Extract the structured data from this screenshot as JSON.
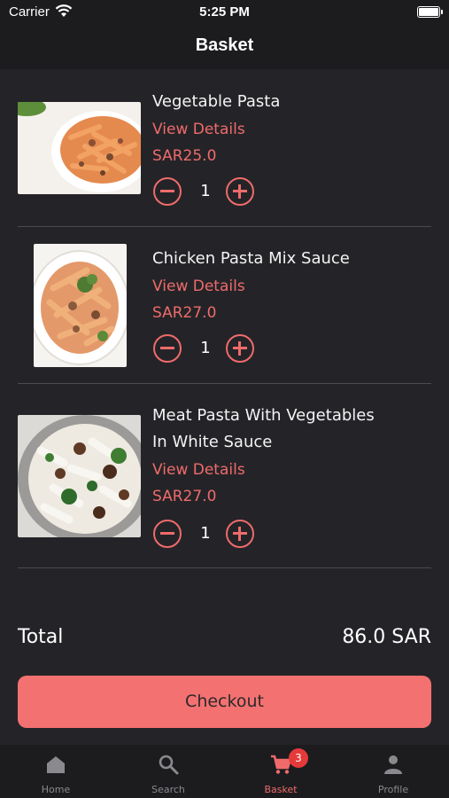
{
  "status_bar": {
    "carrier": "Carrier",
    "time": "5:25 PM"
  },
  "nav": {
    "title": "Basket"
  },
  "basket": {
    "items": [
      {
        "name": "Vegetable Pasta",
        "details_label": "View Details",
        "price": "SAR25.0",
        "quantity": "1"
      },
      {
        "name": "Chicken Pasta Mix Sauce",
        "details_label": "View Details",
        "price": "SAR27.0",
        "quantity": "1"
      },
      {
        "name": "Meat Pasta With Vegetables In White Sauce",
        "details_label": "View Details",
        "price": "SAR27.0",
        "quantity": "1"
      }
    ]
  },
  "summary": {
    "total_label": "Total",
    "total_value": "86.0 SAR",
    "checkout_label": "Checkout"
  },
  "tabs": [
    {
      "label": "Home",
      "icon": "home-icon"
    },
    {
      "label": "Search",
      "icon": "search-icon"
    },
    {
      "label": "Basket",
      "icon": "cart-icon",
      "badge": "3"
    },
    {
      "label": "Profile",
      "icon": "profile-icon"
    }
  ],
  "colors": {
    "accent": "#ef6b6b",
    "background": "#242428",
    "bar": "#1c1c1f",
    "button": "#f47171"
  }
}
